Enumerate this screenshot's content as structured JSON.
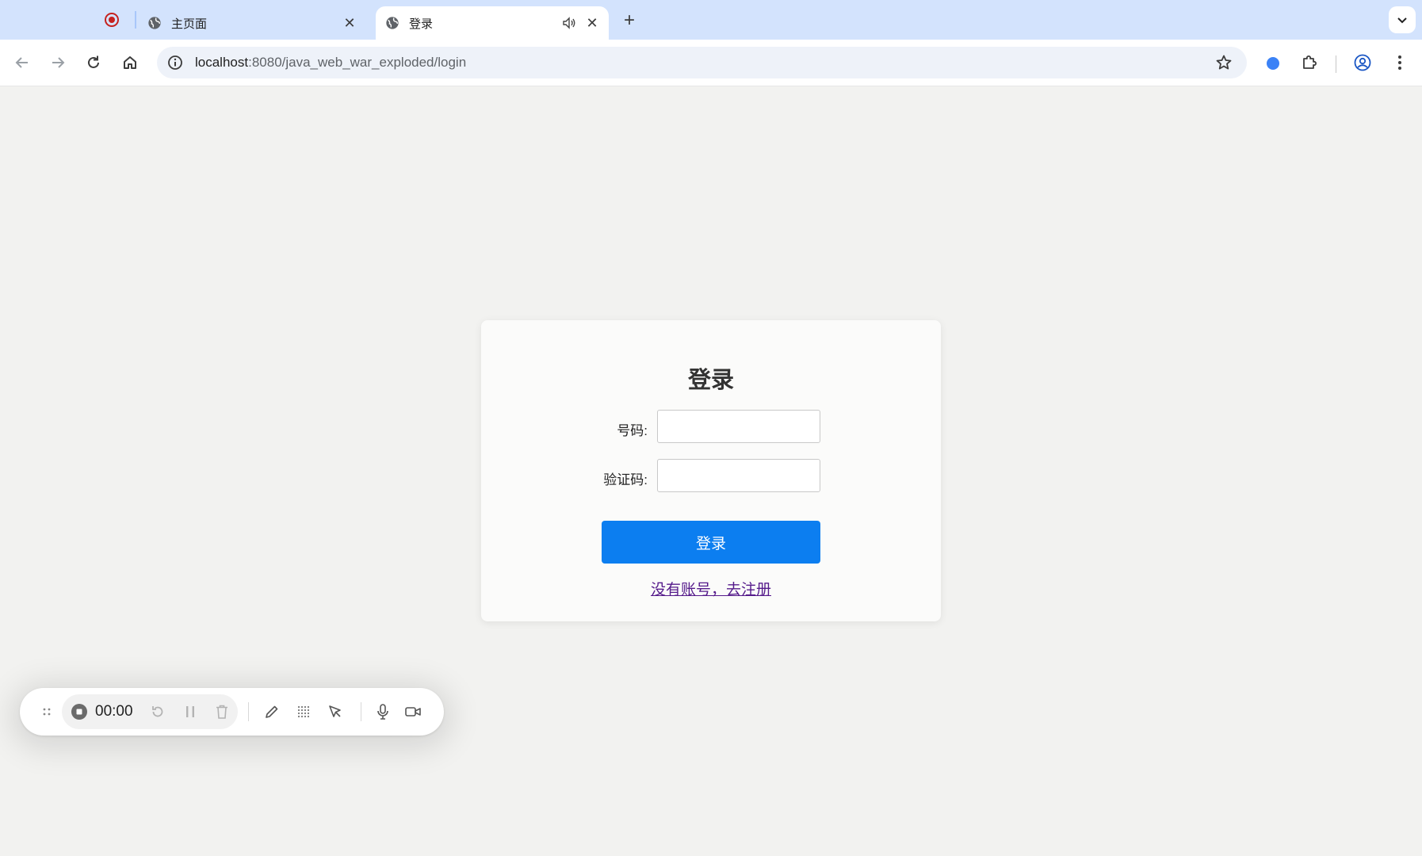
{
  "browser": {
    "tabs": [
      {
        "title": "主页面",
        "active": false
      },
      {
        "title": "登录",
        "active": true
      }
    ],
    "address_bar": {
      "host": "localhost",
      "path": ":8080/java_web_war_exploded/login"
    }
  },
  "login_form": {
    "heading": "登录",
    "phone_label": "号码:",
    "phone_value": "",
    "code_label": "验证码:",
    "code_value": "",
    "submit_label": "登录",
    "register_link": "没有账号，去注册"
  },
  "recorder": {
    "elapsed": "00:00"
  },
  "colors": {
    "tabstrip": "#d3e3fd",
    "primary_button": "#0c7ef0",
    "visited_link": "#551a8b"
  }
}
